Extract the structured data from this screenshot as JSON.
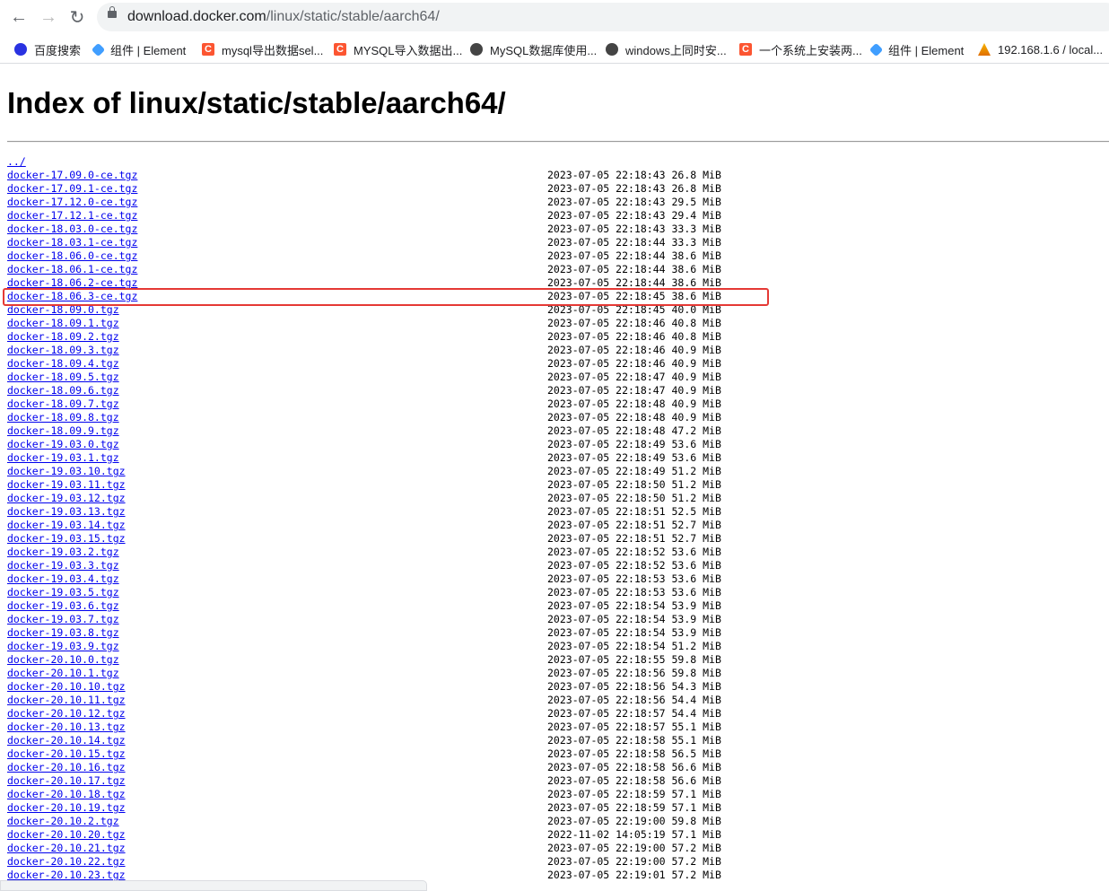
{
  "browser": {
    "url_host": "download.docker.com",
    "url_path": "/linux/static/stable/aarch64/"
  },
  "bookmarks": [
    {
      "label": "百度搜索",
      "icon": "baidu-icon"
    },
    {
      "label": "组件 | Element",
      "icon": "element-icon"
    },
    {
      "label": "mysql导出数据sel...",
      "icon": "csdn-icon"
    },
    {
      "label": "MYSQL导入数据出...",
      "icon": "csdn-icon"
    },
    {
      "label": "MySQL数据库使用...",
      "icon": "globe-icon"
    },
    {
      "label": "windows上同时安...",
      "icon": "globe-icon"
    },
    {
      "label": "一个系统上安装两...",
      "icon": "csdn-icon"
    },
    {
      "label": "组件 | Element",
      "icon": "element-icon"
    },
    {
      "label": "192.168.1.6 / local...",
      "icon": "phpmyadmin-icon"
    }
  ],
  "page": {
    "title": "Index of linux/static/stable/aarch64/",
    "parent_link": "../"
  },
  "files": [
    {
      "name": "docker-17.09.0-ce.tgz",
      "date": "2023-07-05 22:18:43",
      "size": "26.8 MiB"
    },
    {
      "name": "docker-17.09.1-ce.tgz",
      "date": "2023-07-05 22:18:43",
      "size": "26.8 MiB"
    },
    {
      "name": "docker-17.12.0-ce.tgz",
      "date": "2023-07-05 22:18:43",
      "size": "29.5 MiB"
    },
    {
      "name": "docker-17.12.1-ce.tgz",
      "date": "2023-07-05 22:18:43",
      "size": "29.4 MiB"
    },
    {
      "name": "docker-18.03.0-ce.tgz",
      "date": "2023-07-05 22:18:43",
      "size": "33.3 MiB"
    },
    {
      "name": "docker-18.03.1-ce.tgz",
      "date": "2023-07-05 22:18:44",
      "size": "33.3 MiB"
    },
    {
      "name": "docker-18.06.0-ce.tgz",
      "date": "2023-07-05 22:18:44",
      "size": "38.6 MiB"
    },
    {
      "name": "docker-18.06.1-ce.tgz",
      "date": "2023-07-05 22:18:44",
      "size": "38.6 MiB"
    },
    {
      "name": "docker-18.06.2-ce.tgz",
      "date": "2023-07-05 22:18:44",
      "size": "38.6 MiB"
    },
    {
      "name": "docker-18.06.3-ce.tgz",
      "date": "2023-07-05 22:18:45",
      "size": "38.6 MiB"
    },
    {
      "name": "docker-18.09.0.tgz",
      "date": "2023-07-05 22:18:45",
      "size": "40.0 MiB"
    },
    {
      "name": "docker-18.09.1.tgz",
      "date": "2023-07-05 22:18:46",
      "size": "40.8 MiB"
    },
    {
      "name": "docker-18.09.2.tgz",
      "date": "2023-07-05 22:18:46",
      "size": "40.8 MiB"
    },
    {
      "name": "docker-18.09.3.tgz",
      "date": "2023-07-05 22:18:46",
      "size": "40.9 MiB"
    },
    {
      "name": "docker-18.09.4.tgz",
      "date": "2023-07-05 22:18:46",
      "size": "40.9 MiB"
    },
    {
      "name": "docker-18.09.5.tgz",
      "date": "2023-07-05 22:18:47",
      "size": "40.9 MiB"
    },
    {
      "name": "docker-18.09.6.tgz",
      "date": "2023-07-05 22:18:47",
      "size": "40.9 MiB"
    },
    {
      "name": "docker-18.09.7.tgz",
      "date": "2023-07-05 22:18:48",
      "size": "40.9 MiB"
    },
    {
      "name": "docker-18.09.8.tgz",
      "date": "2023-07-05 22:18:48",
      "size": "40.9 MiB"
    },
    {
      "name": "docker-18.09.9.tgz",
      "date": "2023-07-05 22:18:48",
      "size": "47.2 MiB"
    },
    {
      "name": "docker-19.03.0.tgz",
      "date": "2023-07-05 22:18:49",
      "size": "53.6 MiB"
    },
    {
      "name": "docker-19.03.1.tgz",
      "date": "2023-07-05 22:18:49",
      "size": "53.6 MiB"
    },
    {
      "name": "docker-19.03.10.tgz",
      "date": "2023-07-05 22:18:49",
      "size": "51.2 MiB"
    },
    {
      "name": "docker-19.03.11.tgz",
      "date": "2023-07-05 22:18:50",
      "size": "51.2 MiB"
    },
    {
      "name": "docker-19.03.12.tgz",
      "date": "2023-07-05 22:18:50",
      "size": "51.2 MiB"
    },
    {
      "name": "docker-19.03.13.tgz",
      "date": "2023-07-05 22:18:51",
      "size": "52.5 MiB"
    },
    {
      "name": "docker-19.03.14.tgz",
      "date": "2023-07-05 22:18:51",
      "size": "52.7 MiB"
    },
    {
      "name": "docker-19.03.15.tgz",
      "date": "2023-07-05 22:18:51",
      "size": "52.7 MiB"
    },
    {
      "name": "docker-19.03.2.tgz",
      "date": "2023-07-05 22:18:52",
      "size": "53.6 MiB"
    },
    {
      "name": "docker-19.03.3.tgz",
      "date": "2023-07-05 22:18:52",
      "size": "53.6 MiB"
    },
    {
      "name": "docker-19.03.4.tgz",
      "date": "2023-07-05 22:18:53",
      "size": "53.6 MiB"
    },
    {
      "name": "docker-19.03.5.tgz",
      "date": "2023-07-05 22:18:53",
      "size": "53.6 MiB"
    },
    {
      "name": "docker-19.03.6.tgz",
      "date": "2023-07-05 22:18:54",
      "size": "53.9 MiB"
    },
    {
      "name": "docker-19.03.7.tgz",
      "date": "2023-07-05 22:18:54",
      "size": "53.9 MiB"
    },
    {
      "name": "docker-19.03.8.tgz",
      "date": "2023-07-05 22:18:54",
      "size": "53.9 MiB"
    },
    {
      "name": "docker-19.03.9.tgz",
      "date": "2023-07-05 22:18:54",
      "size": "51.2 MiB"
    },
    {
      "name": "docker-20.10.0.tgz",
      "date": "2023-07-05 22:18:55",
      "size": "59.8 MiB"
    },
    {
      "name": "docker-20.10.1.tgz",
      "date": "2023-07-05 22:18:56",
      "size": "59.8 MiB"
    },
    {
      "name": "docker-20.10.10.tgz",
      "date": "2023-07-05 22:18:56",
      "size": "54.3 MiB"
    },
    {
      "name": "docker-20.10.11.tgz",
      "date": "2023-07-05 22:18:56",
      "size": "54.4 MiB"
    },
    {
      "name": "docker-20.10.12.tgz",
      "date": "2023-07-05 22:18:57",
      "size": "54.4 MiB"
    },
    {
      "name": "docker-20.10.13.tgz",
      "date": "2023-07-05 22:18:57",
      "size": "55.1 MiB"
    },
    {
      "name": "docker-20.10.14.tgz",
      "date": "2023-07-05 22:18:58",
      "size": "55.1 MiB"
    },
    {
      "name": "docker-20.10.15.tgz",
      "date": "2023-07-05 22:18:58",
      "size": "56.5 MiB"
    },
    {
      "name": "docker-20.10.16.tgz",
      "date": "2023-07-05 22:18:58",
      "size": "56.6 MiB"
    },
    {
      "name": "docker-20.10.17.tgz",
      "date": "2023-07-05 22:18:58",
      "size": "56.6 MiB"
    },
    {
      "name": "docker-20.10.18.tgz",
      "date": "2023-07-05 22:18:59",
      "size": "57.1 MiB"
    },
    {
      "name": "docker-20.10.19.tgz",
      "date": "2023-07-05 22:18:59",
      "size": "57.1 MiB"
    },
    {
      "name": "docker-20.10.2.tgz",
      "date": "2023-07-05 22:19:00",
      "size": "59.8 MiB"
    },
    {
      "name": "docker-20.10.20.tgz",
      "date": "2022-11-02 14:05:19",
      "size": "57.1 MiB"
    },
    {
      "name": "docker-20.10.21.tgz",
      "date": "2023-07-05 22:19:00",
      "size": "57.2 MiB"
    },
    {
      "name": "docker-20.10.22.tgz",
      "date": "2023-07-05 22:19:00",
      "size": "57.2 MiB"
    },
    {
      "name": "docker-20.10.23.tgz",
      "date": "2023-07-05 22:19:01",
      "size": "57.2 MiB"
    }
  ],
  "highlighted_file": "docker-18.06.3-ce.tgz",
  "colors": {
    "link": "#0000ee",
    "highlight_box": "#e53935"
  }
}
